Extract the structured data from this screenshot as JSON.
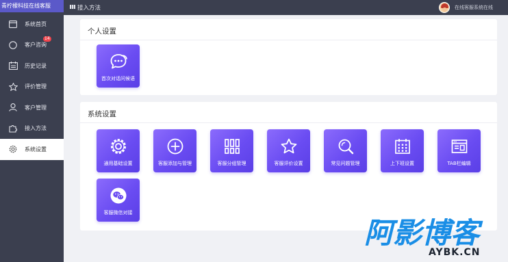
{
  "app": {
    "title": "青柠檬科技在线客服"
  },
  "topbar": {
    "breadcrumb": "接入方法",
    "user_label": "在线客服系统在线"
  },
  "sidebar": {
    "items": [
      {
        "label": "系统首页",
        "icon": "window-icon"
      },
      {
        "label": "客户咨询",
        "icon": "chat-circle-icon",
        "badge": "14"
      },
      {
        "label": "历史记录",
        "icon": "calendar-icon"
      },
      {
        "label": "评价管理",
        "icon": "star-icon"
      },
      {
        "label": "客户管理",
        "icon": "user-icon"
      },
      {
        "label": "接入方法",
        "icon": "puzzle-icon"
      },
      {
        "label": "系统设置",
        "icon": "gear-icon",
        "active": true
      }
    ]
  },
  "personal": {
    "title": "个人设置",
    "tiles": [
      {
        "label": "首次对话问候语",
        "icon": "chat-bubbles-icon"
      }
    ]
  },
  "system": {
    "title": "系统设置",
    "tiles": [
      {
        "label": "通用基础设置",
        "icon": "gear-icon"
      },
      {
        "label": "客服添加与管理",
        "icon": "plus-circle-icon"
      },
      {
        "label": "客服分组管理",
        "icon": "grid-icon"
      },
      {
        "label": "客服评价设置",
        "icon": "star-icon"
      },
      {
        "label": "常见问题管理",
        "icon": "search-icon"
      },
      {
        "label": "上下班设置",
        "icon": "calendar-icon"
      },
      {
        "label": "TAB栏编辑",
        "icon": "browser-window-icon"
      },
      {
        "label": "客服微信对接",
        "icon": "wechat-icon"
      }
    ]
  },
  "watermark": {
    "text": "阿影博客",
    "domain": "AYBK.CN"
  },
  "colors": {
    "accent": "#5b59c9",
    "sidebar": "#3b3f4f",
    "tile_start": "#8b6bfc",
    "tile_end": "#5a3fe6",
    "badge": "#f0454d"
  }
}
